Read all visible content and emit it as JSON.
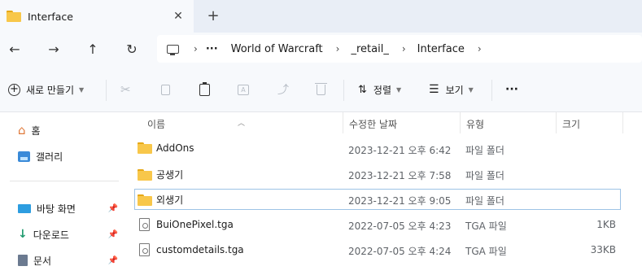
{
  "tab": {
    "title": "Interface",
    "close_glyph": "✕",
    "new_glyph": "+"
  },
  "nav": {
    "back": "←",
    "forward": "→",
    "up": "↑",
    "refresh": "↻"
  },
  "address": {
    "more": "···",
    "sep": "›",
    "crumbs": [
      "World of Warcraft",
      "_retail_",
      "Interface"
    ]
  },
  "toolbar": {
    "new_label": "새로 만들기",
    "sort_label": "정렬",
    "view_label": "보기",
    "more_label": "···"
  },
  "sidebar": {
    "items": [
      {
        "label": "홈",
        "icon": "home-icon"
      },
      {
        "label": "갤러리",
        "icon": "gallery-icon"
      },
      {
        "label": "바탕 화면",
        "icon": "desktop-icon",
        "pinned": true
      },
      {
        "label": "다운로드",
        "icon": "download-icon",
        "pinned": true
      },
      {
        "label": "문서",
        "icon": "documents-icon",
        "pinned": true
      }
    ],
    "pin_glyph": "📌"
  },
  "columns": {
    "name": "이름",
    "date": "수정한 날짜",
    "type": "유형",
    "size": "크기"
  },
  "files": [
    {
      "name": "AddOns",
      "date": "2023-12-21 오후 6:42",
      "type": "파일 폴더",
      "size": "",
      "icon": "folder-icon"
    },
    {
      "name": "공생기",
      "date": "2023-12-21 오후 7:58",
      "type": "파일 폴더",
      "size": "",
      "icon": "folder-icon"
    },
    {
      "name": "외생기",
      "date": "2023-12-21 오후 9:05",
      "type": "파일 폴더",
      "size": "",
      "icon": "folder-icon",
      "selected": true
    },
    {
      "name": "BuiOnePixel.tga",
      "date": "2022-07-05 오후 4:23",
      "type": "TGA 파일",
      "size": "1KB",
      "icon": "file-icon"
    },
    {
      "name": "customdetails.tga",
      "date": "2022-07-05 오후 4:24",
      "type": "TGA 파일",
      "size": "33KB",
      "icon": "file-icon"
    }
  ],
  "colors": {
    "accent": "#0067c0",
    "folder": "#f8c74a",
    "selection_border": "#9ec3e6"
  }
}
